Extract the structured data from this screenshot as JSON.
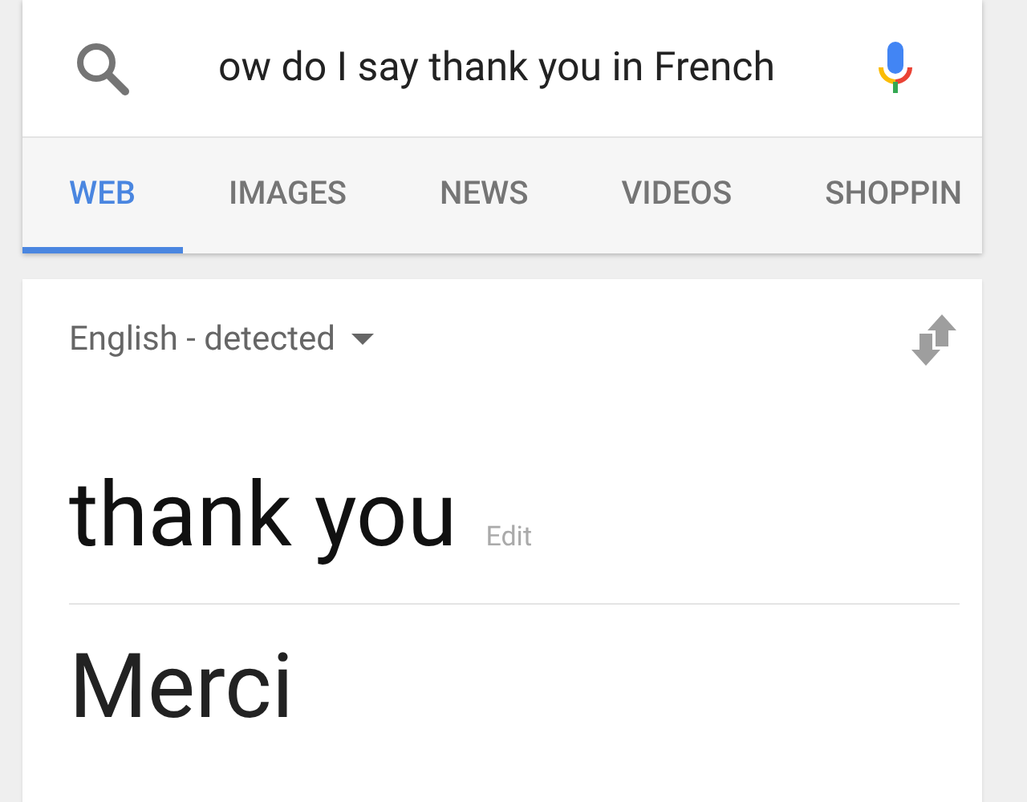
{
  "search": {
    "value": "ow do I say thank you in French"
  },
  "tabs": [
    {
      "label": "WEB",
      "selected": true
    },
    {
      "label": "IMAGES",
      "selected": false
    },
    {
      "label": "NEWS",
      "selected": false
    },
    {
      "label": "VIDEOS",
      "selected": false
    },
    {
      "label": "SHOPPIN",
      "selected": false
    }
  ],
  "translator": {
    "source_language": "English - detected",
    "source_text": "thank you",
    "edit_label": "Edit",
    "translation": "Merci"
  }
}
